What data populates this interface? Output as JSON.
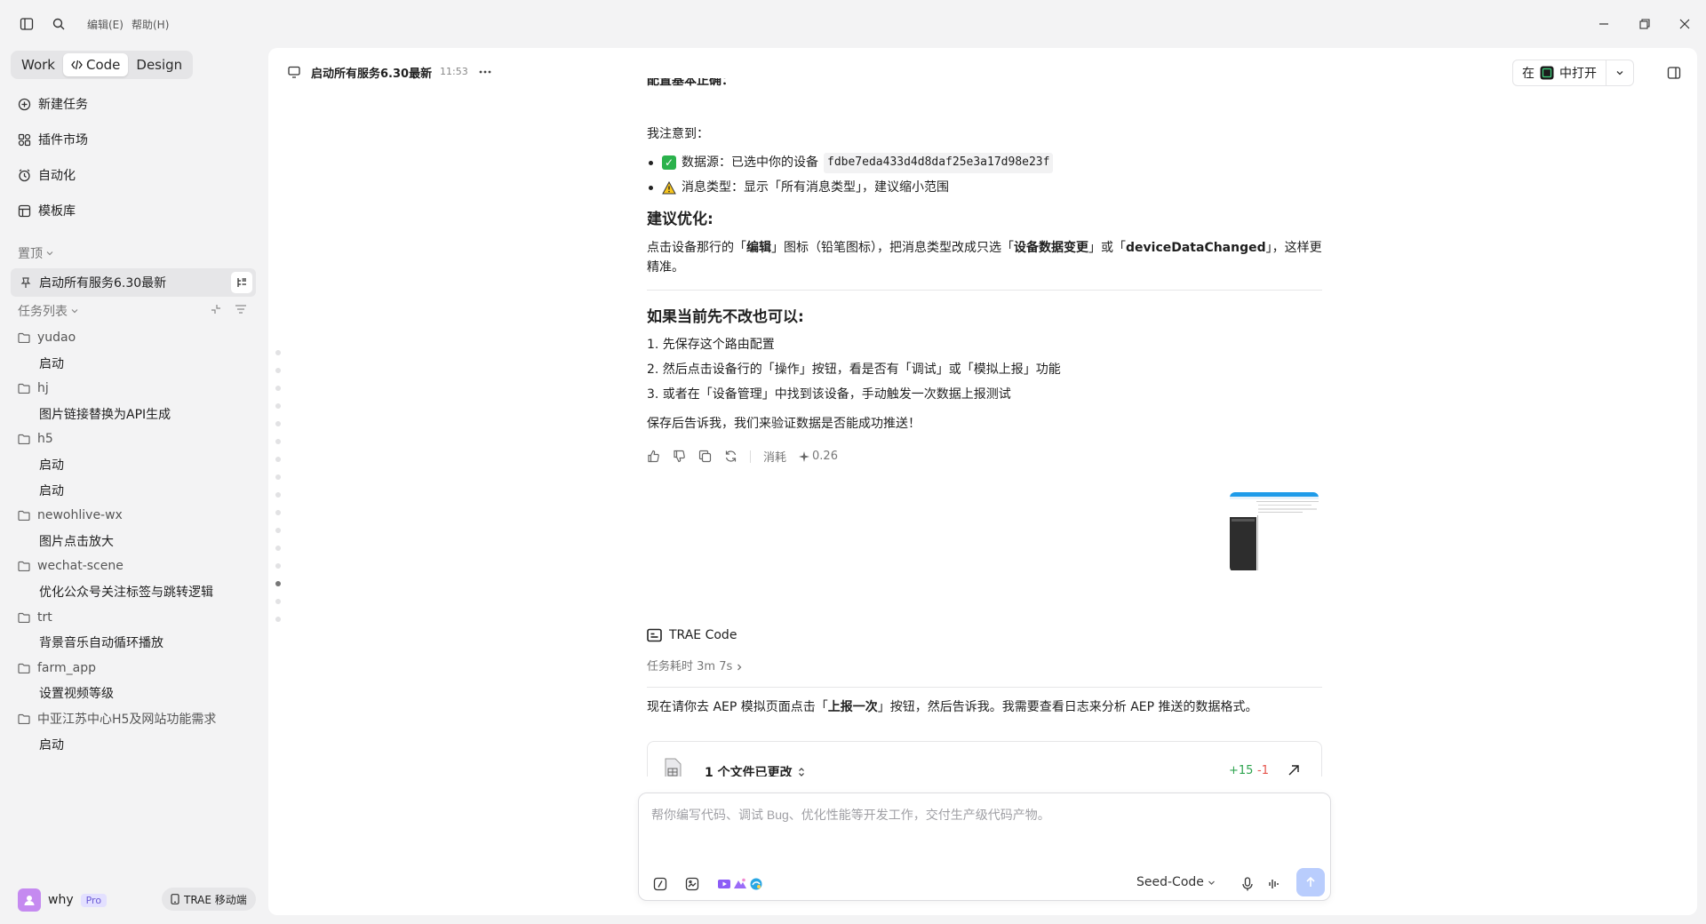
{
  "menu": {
    "edit": "编辑(E)",
    "help": "帮助(H)"
  },
  "colors": {
    "accent": "#4c7df7",
    "success": "#2bb24c",
    "diff_add": "#2ea44f",
    "diff_del": "#e5534b"
  },
  "sidebar": {
    "modes": [
      "Work",
      "Code",
      "Design"
    ],
    "active_mode": "Code",
    "nav": [
      {
        "label": "新建任务",
        "icon": "plus-circle-icon"
      },
      {
        "label": "插件市场",
        "icon": "plugin-icon"
      },
      {
        "label": "自动化",
        "icon": "clock-icon"
      },
      {
        "label": "模板库",
        "icon": "template-icon"
      }
    ],
    "pinned_title": "置顶",
    "pinned_item": "启动所有服务6.30最新",
    "tasks_title": "任务列表",
    "tree": [
      {
        "type": "folder",
        "label": "yudao"
      },
      {
        "type": "task",
        "label": "启动"
      },
      {
        "type": "folder",
        "label": "hj"
      },
      {
        "type": "task",
        "label": "图片链接替换为API生成"
      },
      {
        "type": "folder",
        "label": "h5"
      },
      {
        "type": "task",
        "label": "启动"
      },
      {
        "type": "task",
        "label": "启动"
      },
      {
        "type": "folder",
        "label": "newohlive-wx"
      },
      {
        "type": "task",
        "label": "图片点击放大"
      },
      {
        "type": "folder",
        "label": "wechat-scene"
      },
      {
        "type": "task",
        "label": "优化公众号关注标签与跳转逻辑"
      },
      {
        "type": "folder",
        "label": "trt"
      },
      {
        "type": "task",
        "label": "背景音乐自动循环播放"
      },
      {
        "type": "folder",
        "label": "farm_app"
      },
      {
        "type": "task",
        "label": "设置视频等级"
      },
      {
        "type": "folder",
        "label": "中亚江苏中心H5及网站功能需求"
      },
      {
        "type": "task",
        "label": "启动"
      }
    ],
    "user": {
      "name": "why",
      "badge": "Pro"
    },
    "mobile_button": "TRAE 移动端"
  },
  "header": {
    "title": "启动所有服务6.30最新",
    "time": "11:53",
    "open_prefix": "在",
    "open_suffix": "中打开"
  },
  "chat": {
    "partial_top": "配置基本正确：",
    "noticed": "我注意到：",
    "check_label": "数据源：已选中你的设备",
    "device_code": "fdbe7eda433d4d8daf25e3a17d98e23f",
    "warn_label": "消息类型：显示「所有消息类型」，建议缩小范围",
    "suggest_title": "建议优化:",
    "suggest_p1": "点击设备那行的「",
    "suggest_b1": "编辑",
    "suggest_p2": "」图标（铅笔图标），把消息类型改成只选「",
    "suggest_b2": "设备数据变更",
    "suggest_p3": "」或「",
    "suggest_b3": "deviceDataChanged",
    "suggest_p4": "」，这样更精准。",
    "alt_title": "如果当前先不改也可以:",
    "steps": [
      "1. 先保存这个路由配置",
      "2. 然后点击设备行的「操作」按钮，看是否有「调试」或「模拟上报」功能",
      "3. 或者在「设备管理」中找到该设备，手动触发一次数据上报测试"
    ],
    "closing": "保存后告诉我，我们来验证数据是否能成功推送！",
    "cost_label": "消耗",
    "cost_value": "0.26",
    "agent_name": "TRAE Code",
    "duration": "任务耗时 3m 7s",
    "reply_p1": "现在请你去 AEP 模拟页面点击「",
    "reply_b1": "上报一次",
    "reply_p2": "」按钮，然后告诉我。我需要查看日志来分析 AEP 推送的数据格式。",
    "files_changed": "1 个文件已更改",
    "diff_add": "+15",
    "diff_del": "-1"
  },
  "input": {
    "placeholder": "帮你编写代码、调试 Bug、优化性能等开发工作，交付生产级代码产物。",
    "model": "Seed-Code"
  }
}
